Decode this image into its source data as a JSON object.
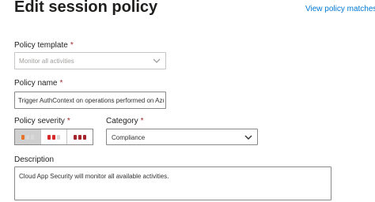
{
  "page": {
    "title": "Edit session policy",
    "link": "View policy matches ("
  },
  "template": {
    "label": "Policy template",
    "required": "*",
    "value": "Monitor all activities"
  },
  "name": {
    "label": "Policy name",
    "required": "*",
    "value": "Trigger AuthContext on operations performed on Azu"
  },
  "severity": {
    "label": "Policy severity",
    "required": "*",
    "options": [
      {
        "name": "low",
        "colors": [
          "#e8732a",
          "#d9d9d9",
          "#d9d9d9"
        ],
        "selected": true
      },
      {
        "name": "medium",
        "colors": [
          "#d72b2b",
          "#d72b2b",
          "#d9d9d9"
        ],
        "selected": false
      },
      {
        "name": "high",
        "colors": [
          "#a4262c",
          "#a4262c",
          "#a4262c"
        ],
        "selected": false
      }
    ]
  },
  "category": {
    "label": "Category",
    "required": "*",
    "value": "Compliance"
  },
  "description": {
    "label": "Description",
    "value": "Cloud App Security will monitor all available activities."
  }
}
